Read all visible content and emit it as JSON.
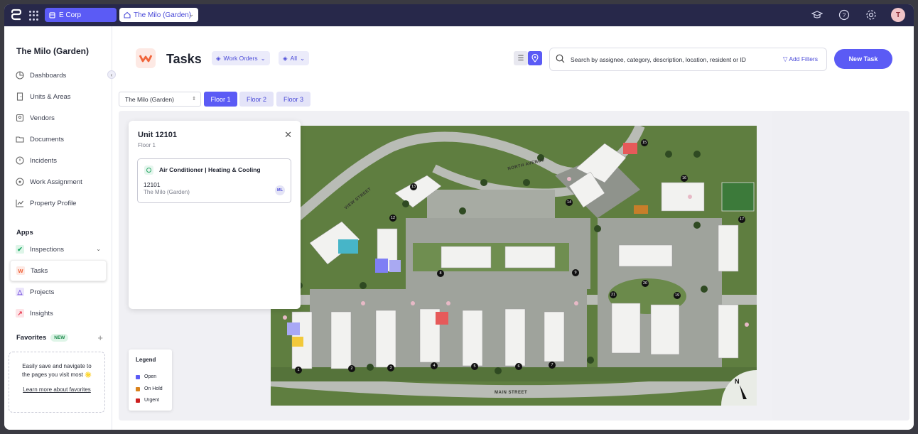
{
  "topbar": {
    "org_name": "E Corp",
    "property_name": "The Milo (Garden)",
    "user_initial": "T"
  },
  "sidebar": {
    "title": "The Milo (Garden)",
    "items": [
      {
        "label": "Dashboards",
        "icon": "dashboard-icon"
      },
      {
        "label": "Units & Areas",
        "icon": "door-icon"
      },
      {
        "label": "Vendors",
        "icon": "vendor-icon"
      },
      {
        "label": "Documents",
        "icon": "folder-icon"
      },
      {
        "label": "Incidents",
        "icon": "alert-icon"
      },
      {
        "label": "Work Assignment",
        "icon": "assignment-icon"
      },
      {
        "label": "Property Profile",
        "icon": "chart-line-icon"
      }
    ],
    "apps_label": "Apps",
    "apps": [
      {
        "label": "Inspections",
        "icon": "inspections-icon",
        "color": "#1daa66"
      },
      {
        "label": "Tasks",
        "icon": "tasks-icon",
        "color": "#f0643a"
      },
      {
        "label": "Projects",
        "icon": "projects-icon",
        "color": "#7a56e0"
      },
      {
        "label": "Insights",
        "icon": "insights-icon",
        "color": "#e8344a"
      }
    ],
    "favorites_label": "Favorites",
    "favorites_badge": "NEW",
    "favorites_text": "Easily save and navigate to the pages you visit most 🌟",
    "favorites_link": "Learn more about favorites"
  },
  "header": {
    "title": "Tasks",
    "filter_type": "Work Orders",
    "filter_scope": "All",
    "search_placeholder": "Search by assignee, category, description, location, resident or ID",
    "add_filters": "Add Filters",
    "new_task": "New Task"
  },
  "floors": {
    "property_select": "The Milo (Garden)",
    "tabs": [
      "Floor 1",
      "Floor 2",
      "Floor 3"
    ],
    "active": "Floor 1"
  },
  "unit_panel": {
    "title": "Unit 12101",
    "floor": "Floor 1",
    "work_order": {
      "category": "Air Conditioner | Heating & Cooling",
      "unit": "12101",
      "property": "The Milo (Garden)",
      "assignee_initials": "ML"
    }
  },
  "legend": {
    "title": "Legend",
    "items": [
      {
        "label": "Open",
        "color": "#5b5bf5"
      },
      {
        "label": "On Hold",
        "color": "#d9821c"
      },
      {
        "label": "Urgent",
        "color": "#cc1f1f"
      }
    ]
  },
  "map": {
    "street_north": "NORTH AVENUE",
    "street_main": "MAIN STREET",
    "street_view": "VIEW STREET",
    "compass": "N",
    "building_numbers": [
      "1",
      "2",
      "3",
      "4",
      "5",
      "6",
      "7",
      "8",
      "9",
      "12",
      "13",
      "14",
      "15",
      "16",
      "17",
      "19",
      "20",
      "21"
    ]
  }
}
